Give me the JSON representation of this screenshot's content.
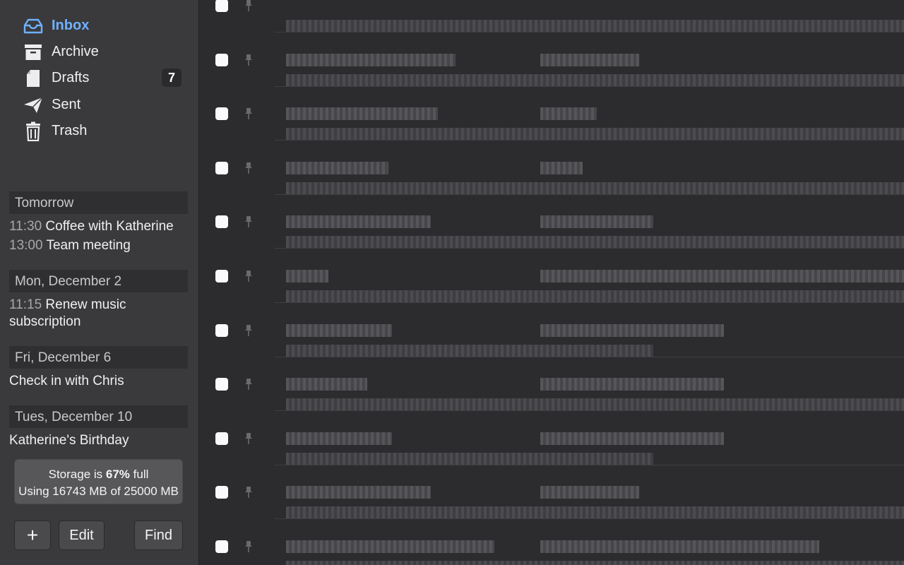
{
  "sidebar": {
    "mailboxes": [
      {
        "label": "Inbox",
        "icon": "inbox-tray-icon",
        "active": true
      },
      {
        "label": "Archive",
        "icon": "archive-box-icon"
      },
      {
        "label": "Drafts",
        "icon": "draft-document-icon",
        "badge": "7"
      },
      {
        "label": "Sent",
        "icon": "paper-plane-icon"
      },
      {
        "label": "Trash",
        "icon": "trash-can-icon"
      }
    ],
    "agenda": [
      {
        "header": "Tomorrow",
        "events": [
          {
            "time": "11:30",
            "title": "Coffee with Katherine"
          },
          {
            "time": "13:00",
            "title": "Team meeting"
          }
        ]
      },
      {
        "header": "Mon, December 2",
        "events": [
          {
            "time": "11:15",
            "title": "Renew music",
            "title_cont": "subscription"
          }
        ]
      },
      {
        "header": "Fri, December 6",
        "events": [
          {
            "time": "",
            "title": "Check in with Chris"
          }
        ]
      },
      {
        "header": "Tues, December 10",
        "events": [
          {
            "time": "",
            "title": "Katherine's Birthday"
          }
        ]
      }
    ],
    "storage": {
      "prefix": "Storage is",
      "percent": "67%",
      "suffix": "full",
      "usage": "Using 16743 MB of 25000 MB",
      "percent_value": 67
    },
    "buttons": {
      "add": "+",
      "edit": "Edit",
      "find": "Find"
    }
  },
  "mail_list": {
    "note": "",
    "row_count": 11
  },
  "colors": {
    "accent": "#6fb1ff",
    "sidebar_bg": "#3a3a3c",
    "list_bg": "#2c2c2e"
  }
}
